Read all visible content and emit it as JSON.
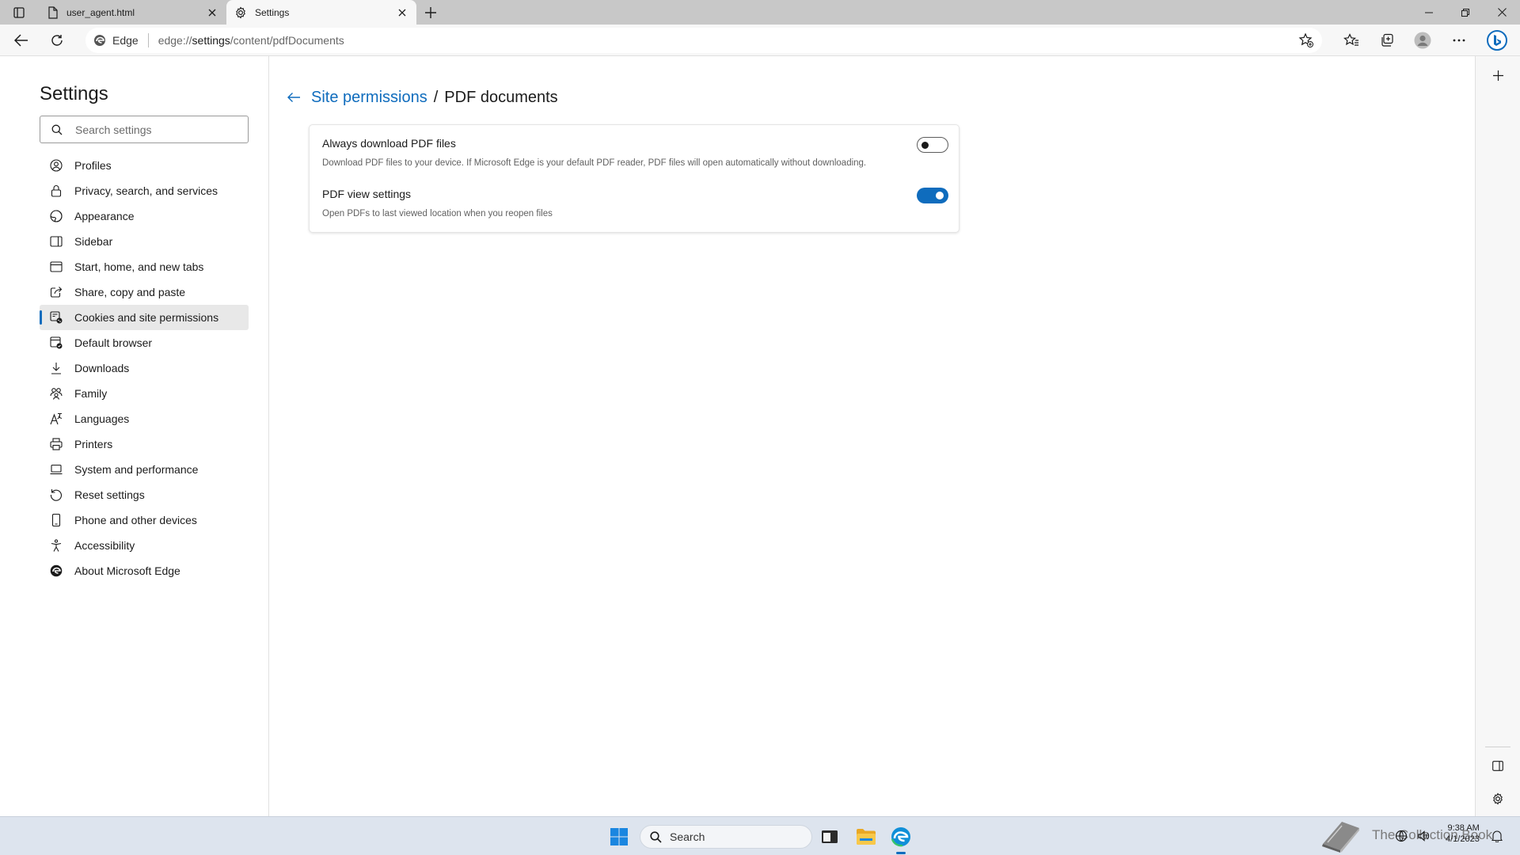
{
  "browser": {
    "tabs": [
      {
        "title": "user_agent.html",
        "active": false
      },
      {
        "title": "Settings",
        "active": true
      }
    ],
    "address": {
      "site_name": "Edge",
      "url_prefix": "edge://",
      "url_host": "settings",
      "url_path": "/content/pdfDocuments"
    }
  },
  "settings": {
    "title": "Settings",
    "search_placeholder": "Search settings",
    "nav": [
      {
        "label": "Profiles",
        "icon": "profile-icon"
      },
      {
        "label": "Privacy, search, and services",
        "icon": "lock-icon"
      },
      {
        "label": "Appearance",
        "icon": "appearance-icon"
      },
      {
        "label": "Sidebar",
        "icon": "sidebar-icon"
      },
      {
        "label": "Start, home, and new tabs",
        "icon": "home-icon"
      },
      {
        "label": "Share, copy and paste",
        "icon": "share-icon"
      },
      {
        "label": "Cookies and site permissions",
        "icon": "cookies-icon",
        "active": true
      },
      {
        "label": "Default browser",
        "icon": "browser-icon"
      },
      {
        "label": "Downloads",
        "icon": "download-icon"
      },
      {
        "label": "Family",
        "icon": "family-icon"
      },
      {
        "label": "Languages",
        "icon": "language-icon"
      },
      {
        "label": "Printers",
        "icon": "printer-icon"
      },
      {
        "label": "System and performance",
        "icon": "laptop-icon"
      },
      {
        "label": "Reset settings",
        "icon": "reset-icon"
      },
      {
        "label": "Phone and other devices",
        "icon": "phone-icon"
      },
      {
        "label": "Accessibility",
        "icon": "accessibility-icon"
      },
      {
        "label": "About Microsoft Edge",
        "icon": "edge-icon"
      }
    ]
  },
  "page": {
    "breadcrumb_parent": "Site permissions",
    "breadcrumb_separator": "/",
    "breadcrumb_current": "PDF documents",
    "settings": [
      {
        "title": "Always download PDF files",
        "description": "Download PDF files to your device. If Microsoft Edge is your default PDF reader, PDF files will open automatically without downloading.",
        "enabled": false
      },
      {
        "title": "PDF view settings",
        "description": "Open PDFs to last viewed location when you reopen files",
        "enabled": true
      }
    ]
  },
  "taskbar": {
    "search_label": "Search",
    "watermark": "The Collection Book",
    "time": "9:38 AM",
    "date": "4/1/2023"
  },
  "colors": {
    "accent": "#0f6cbd",
    "tabstrip": "#c8c8c8",
    "taskbar": "#dde4ee"
  }
}
